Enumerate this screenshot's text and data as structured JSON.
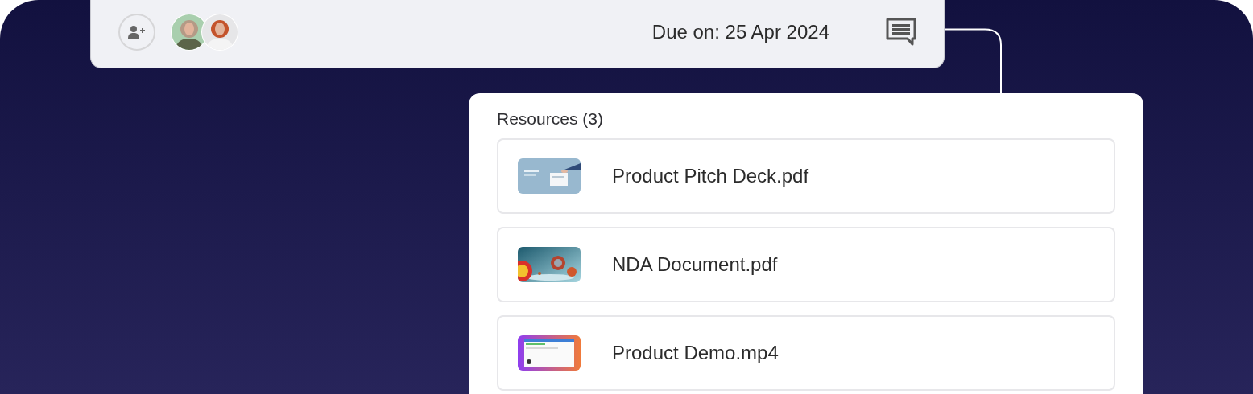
{
  "task_card": {
    "due": "Due on: 25 Apr 2024"
  },
  "resources": {
    "title": "Resources (3)",
    "items": [
      {
        "name": "Product Pitch Deck.pdf"
      },
      {
        "name": "NDA Document.pdf"
      },
      {
        "name": "Product Demo.mp4"
      }
    ]
  }
}
